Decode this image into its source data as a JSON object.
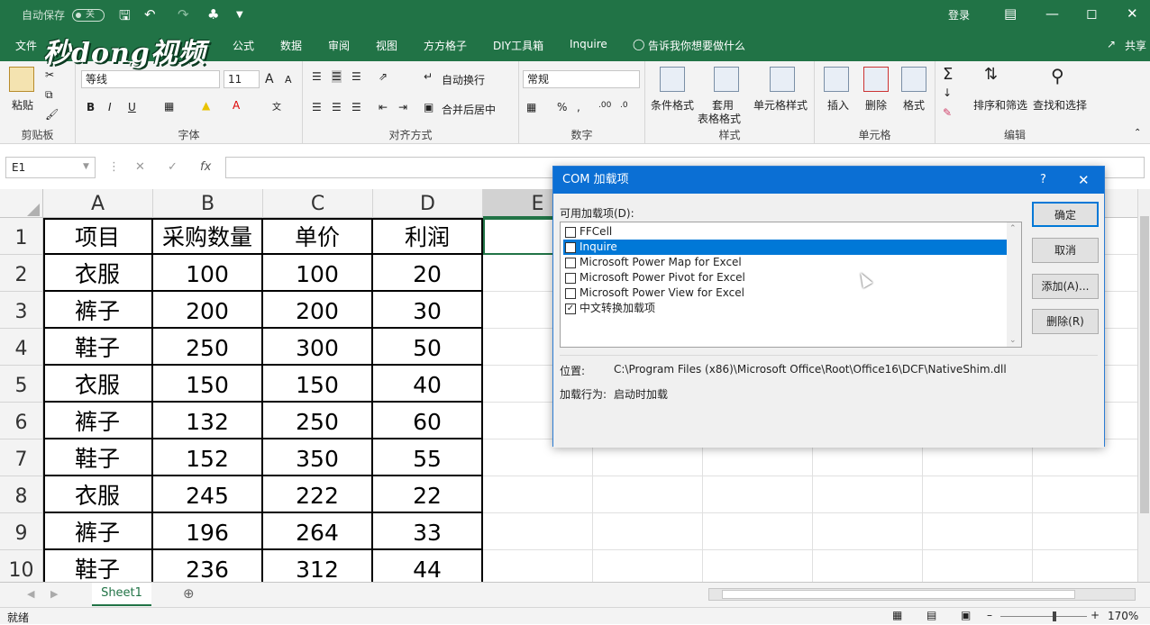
{
  "titlebar": {
    "autosave_label": "自动保存",
    "autosave_state": "关",
    "login": "登录"
  },
  "logo": "秒dong视频",
  "tabs": [
    "文件",
    "公式",
    "数据",
    "审阅",
    "视图",
    "方方格子",
    "DIY工具箱",
    "Inquire",
    "告诉我你想要做什么",
    "共享"
  ],
  "ribbon": {
    "clipboard": {
      "paste": "粘贴",
      "label": "剪贴板"
    },
    "font": {
      "name": "等线",
      "size": "11",
      "label": "字体",
      "bold": "B",
      "italic": "I",
      "underline": "U",
      "grow": "A",
      "shrink": "A"
    },
    "alignment": {
      "wrap": "自动换行",
      "merge": "合并后居中",
      "label": "对齐方式"
    },
    "number": {
      "format": "常规",
      "label": "数字"
    },
    "styles": {
      "conditional": "条件格式",
      "table": "套用",
      "table2": "表格格式",
      "cell": "单元格样式",
      "label": "样式"
    },
    "cells": {
      "insert": "插入",
      "delete": "删除",
      "format": "格式",
      "label": "单元格"
    },
    "editing": {
      "sort": "排序和筛选",
      "find": "查找和选择",
      "label": "编辑"
    }
  },
  "namebox": "E1",
  "columns": [
    "A",
    "B",
    "C",
    "D",
    "E"
  ],
  "rows": [
    "1",
    "2",
    "3",
    "4",
    "5",
    "6",
    "7",
    "8",
    "9",
    "10"
  ],
  "table": [
    [
      "项目",
      "采购数量",
      "单价",
      "利润"
    ],
    [
      "衣服",
      "100",
      "100",
      "20"
    ],
    [
      "裤子",
      "200",
      "200",
      "30"
    ],
    [
      "鞋子",
      "250",
      "300",
      "50"
    ],
    [
      "衣服",
      "150",
      "150",
      "40"
    ],
    [
      "裤子",
      "132",
      "250",
      "60"
    ],
    [
      "鞋子",
      "152",
      "350",
      "55"
    ],
    [
      "衣服",
      "245",
      "222",
      "22"
    ],
    [
      "裤子",
      "196",
      "264",
      "33"
    ],
    [
      "鞋子",
      "236",
      "312",
      "44"
    ]
  ],
  "sheet_tab": "Sheet1",
  "status": {
    "ready": "就绪",
    "zoom": "170%"
  },
  "dialog": {
    "title": "COM 加载项",
    "help": "?",
    "list_label": "可用加载项(D):",
    "items": [
      {
        "name": "FFCell",
        "checked": false
      },
      {
        "name": "Inquire",
        "checked": false
      },
      {
        "name": "Microsoft Power Map for Excel",
        "checked": false
      },
      {
        "name": "Microsoft Power Pivot for Excel",
        "checked": false
      },
      {
        "name": "Microsoft Power View for Excel",
        "checked": false
      },
      {
        "name": "中文转换加载项",
        "checked": true
      }
    ],
    "buttons": {
      "ok": "确定",
      "cancel": "取消",
      "add": "添加(A)...",
      "remove": "删除(R)"
    },
    "location_label": "位置:",
    "location_value": "C:\\Program Files (x86)\\Microsoft Office\\Root\\Office16\\DCF\\NativeShim.dll",
    "behavior_label": "加载行为:",
    "behavior_value": "启动时加载"
  }
}
